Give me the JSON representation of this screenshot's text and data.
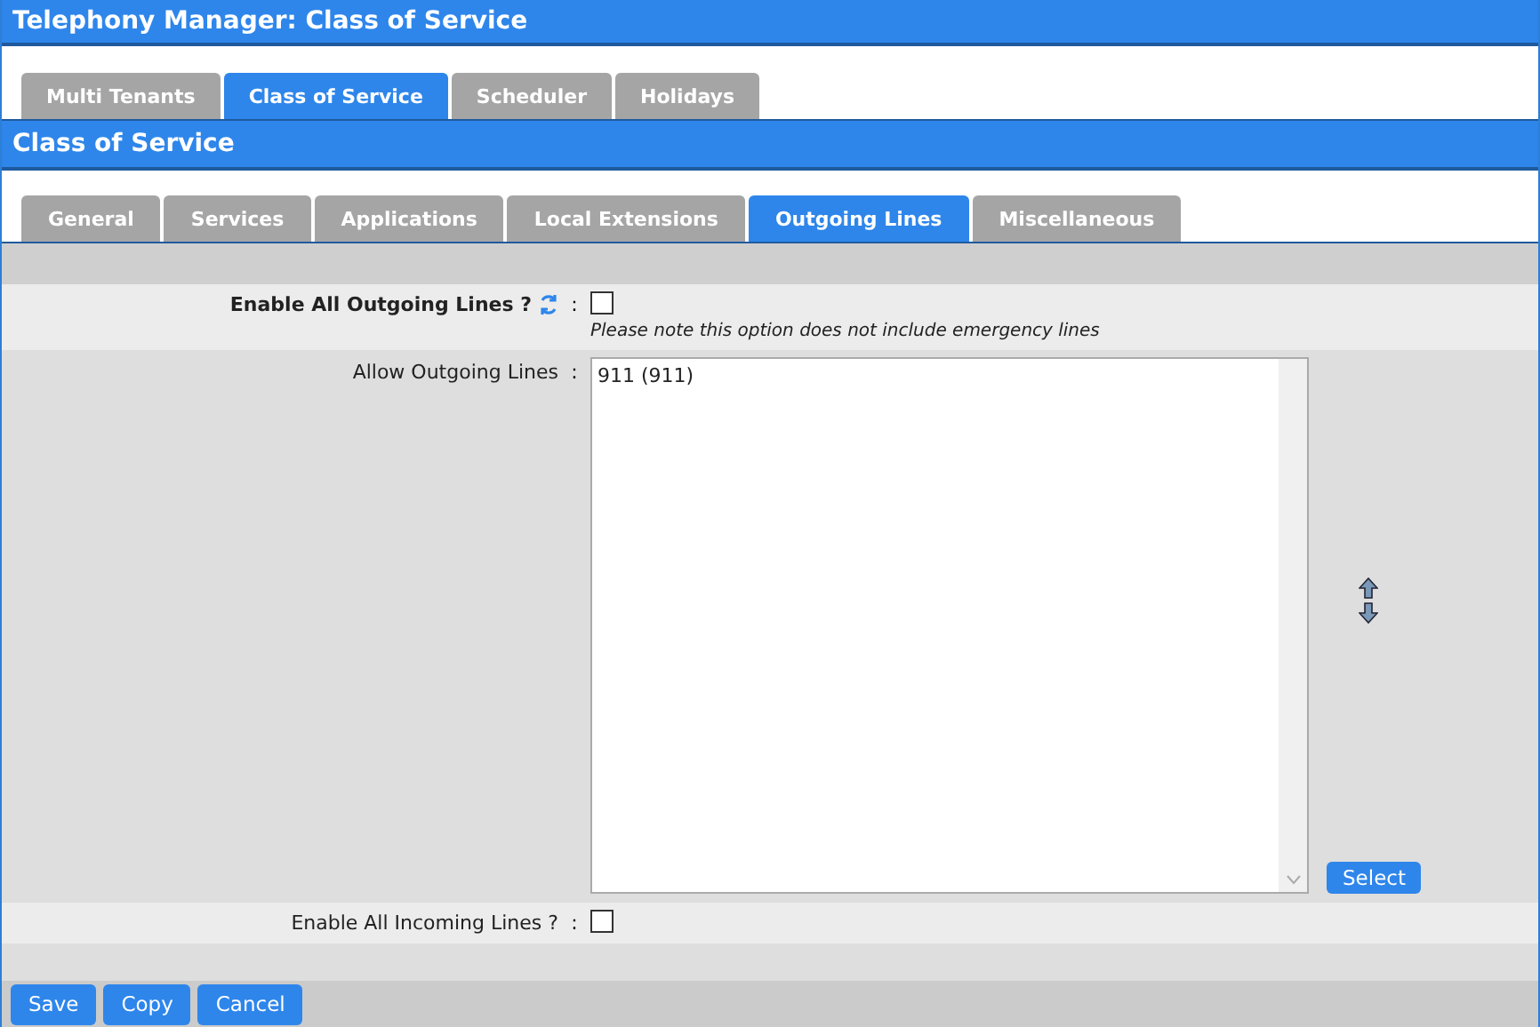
{
  "window": {
    "title": "Telephony Manager:  Class of Service"
  },
  "main_tabs": [
    {
      "label": "Multi Tenants",
      "selected": false
    },
    {
      "label": "Class of Service",
      "selected": true
    },
    {
      "label": "Scheduler",
      "selected": false
    },
    {
      "label": "Holidays",
      "selected": false
    }
  ],
  "section": {
    "title": "Class of Service"
  },
  "sub_tabs": [
    {
      "label": "General",
      "selected": false
    },
    {
      "label": "Services",
      "selected": false
    },
    {
      "label": "Applications",
      "selected": false
    },
    {
      "label": "Local Extensions",
      "selected": false
    },
    {
      "label": "Outgoing Lines",
      "selected": true
    },
    {
      "label": "Miscellaneous",
      "selected": false
    }
  ],
  "enable_outgoing": {
    "label": "Enable All Outgoing Lines ?",
    "separator": ":",
    "checked": false,
    "note": "Please note this option does not include emergency lines"
  },
  "allow_outgoing": {
    "label": "Allow Outgoing Lines",
    "separator": ":",
    "items": [
      "911 (911)"
    ],
    "select_button": "Select"
  },
  "enable_incoming": {
    "label": "Enable All Incoming Lines ?",
    "separator": ":",
    "checked": false
  },
  "buttons": [
    "Save",
    "Copy",
    "Cancel"
  ]
}
